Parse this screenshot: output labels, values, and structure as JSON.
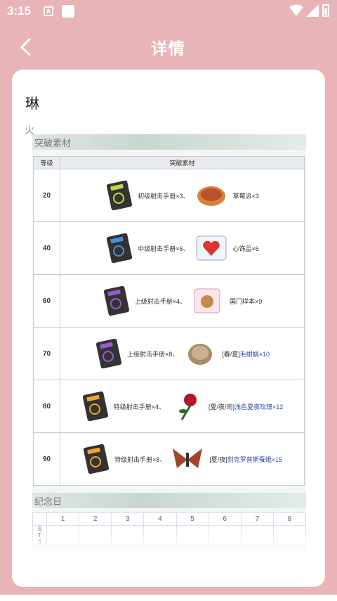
{
  "status": {
    "time": "3:15",
    "a_icon": "A"
  },
  "header": {
    "title": "详情",
    "back_icon": "chevron-left-icon"
  },
  "character": {
    "name": "琳",
    "element": "火"
  },
  "breakthrough": {
    "section_title": "突破素材",
    "col_level": "等级",
    "col_materials": "突破素材",
    "rows": [
      {
        "level": "20",
        "book": "初级射击手册×3、",
        "item": "草莓派×3",
        "book_color": "#c9d64a",
        "item_kind": "pie"
      },
      {
        "level": "40",
        "book": "中级射击手册×6、",
        "item": "心饰品×6",
        "book_color": "#4a8fe0",
        "item_kind": "heart"
      },
      {
        "level": "60",
        "book": "上级射击手册×4、",
        "item": "国门样本×9",
        "book_color": "#9b59d0",
        "item_kind": "sample"
      },
      {
        "level": "70",
        "book": "上级射击手册×8、",
        "item_prefix": "[春/夏]",
        "item": "毛蚶蜗×10",
        "book_color": "#9b59d0",
        "item_kind": "shell"
      },
      {
        "level": "80",
        "book": "特级射击手册×4、",
        "item_prefix": "[夏/夜/雨]",
        "item": "浅色夏夜玫瑰×12",
        "book_color": "#f0a52a",
        "item_kind": "rose"
      },
      {
        "level": "90",
        "book": "特级射击手册×8、",
        "item_prefix": "[夏/夜]",
        "item": "刻克罗普斯蚕蛾×15",
        "book_color": "#f0a52a",
        "item_kind": "moth"
      }
    ]
  },
  "anniversary": {
    "section_title": "纪念日",
    "days": [
      "1",
      "2",
      "3",
      "4",
      "5",
      "6",
      "7",
      "8"
    ],
    "side_label": [
      "S",
      "T",
      "6"
    ]
  }
}
